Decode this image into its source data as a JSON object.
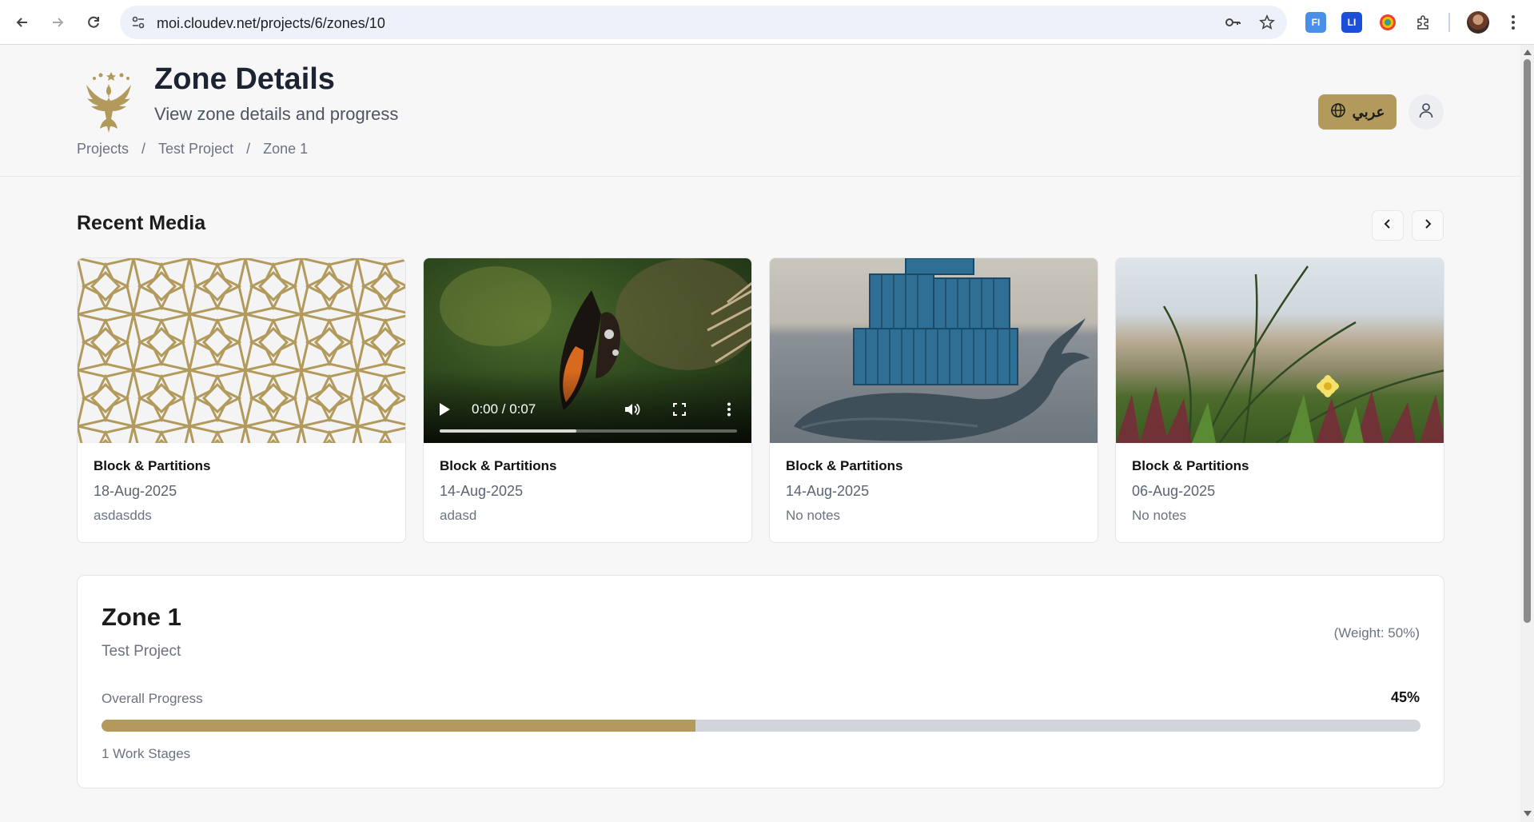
{
  "browser": {
    "url": "moi.cloudev.net/projects/6/zones/10",
    "extensions": [
      "FI",
      "LI"
    ]
  },
  "header": {
    "title": "Zone Details",
    "subtitle": "View zone details and progress",
    "breadcrumb": [
      "Projects",
      "Test Project",
      "Zone 1"
    ],
    "breadcrumb_separator": "/",
    "language_button": "عربي",
    "accent_color": "#b29a5c"
  },
  "recent_media": {
    "title": "Recent Media",
    "items": [
      {
        "title": "Block & Partitions",
        "date": "18-Aug-2025",
        "note": "asdasdds",
        "kind": "image-pattern"
      },
      {
        "title": "Block & Partitions",
        "date": "14-Aug-2025",
        "note": "adasd",
        "kind": "video",
        "time": "0:00 / 0:07",
        "progress": 0.46
      },
      {
        "title": "Block & Partitions",
        "date": "14-Aug-2025",
        "note": "No notes",
        "kind": "image-whale"
      },
      {
        "title": "Block & Partitions",
        "date": "06-Aug-2025",
        "note": "No notes",
        "kind": "image-flower"
      }
    ]
  },
  "zone": {
    "title": "Zone 1",
    "project": "Test Project",
    "weight": "(Weight: 50%)",
    "progress_label": "Overall Progress",
    "progress_value": "45%",
    "progress_fraction": 0.45,
    "stages": "1 Work Stages"
  }
}
